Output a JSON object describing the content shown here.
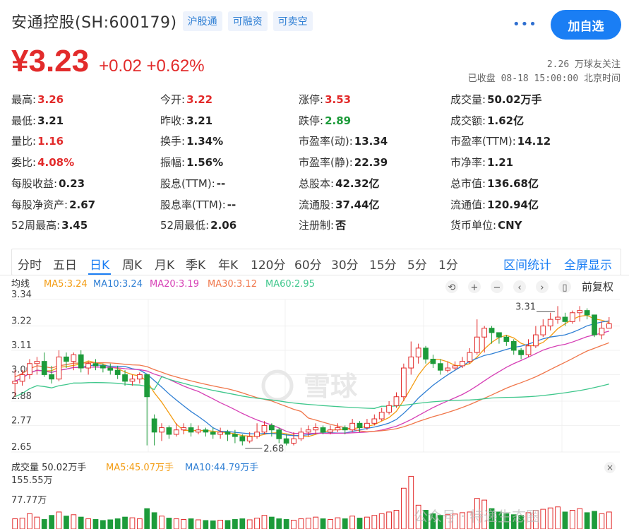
{
  "header": {
    "stock_name": "安通控股(SH:600179)",
    "tags": [
      "沪股通",
      "可融资",
      "可卖空"
    ],
    "add_button": "加自选",
    "more_icon": "more-dots-icon"
  },
  "price": {
    "current": "¥3.23",
    "change": "+0.02 +0.62%",
    "followers": "2.26 万球友关注",
    "status": "已收盘 08-18 15:00:00 北京时间"
  },
  "quote": {
    "rows": [
      [
        [
          "最高:",
          "3.26",
          "red"
        ],
        [
          "今开:",
          "3.22",
          "red"
        ],
        [
          "涨停:",
          "3.53",
          "red"
        ],
        [
          "成交量:",
          "50.02万手",
          ""
        ]
      ],
      [
        [
          "最低:",
          "3.21",
          ""
        ],
        [
          "昨收:",
          "3.21",
          ""
        ],
        [
          "跌停:",
          "2.89",
          "green"
        ],
        [
          "成交额:",
          "1.62亿",
          ""
        ]
      ],
      [
        [
          "量比:",
          "1.16",
          "red"
        ],
        [
          "换手:",
          "1.34%",
          ""
        ],
        [
          "市盈率(动):",
          "13.34",
          ""
        ],
        [
          "市盈率(TTM):",
          "14.12",
          ""
        ]
      ],
      [
        [
          "委比:",
          "4.08%",
          "red"
        ],
        [
          "振幅:",
          "1.56%",
          ""
        ],
        [
          "市盈率(静):",
          "22.39",
          ""
        ],
        [
          "市净率:",
          "1.21",
          ""
        ]
      ],
      [
        [
          "每股收益:",
          "0.23",
          ""
        ],
        [
          "股息(TTM):",
          "--",
          ""
        ],
        [
          "总股本:",
          "42.32亿",
          ""
        ],
        [
          "总市值:",
          "136.68亿",
          ""
        ]
      ],
      [
        [
          "每股净资产:",
          "2.67",
          ""
        ],
        [
          "股息率(TTM):",
          "--",
          ""
        ],
        [
          "流通股:",
          "37.44亿",
          ""
        ],
        [
          "流通值:",
          "120.94亿",
          ""
        ]
      ],
      [
        [
          "52周最高:",
          "3.45",
          ""
        ],
        [
          "52周最低:",
          "2.06",
          ""
        ],
        [
          "注册制:",
          "否",
          ""
        ],
        [
          "货币单位:",
          "CNY",
          ""
        ]
      ]
    ]
  },
  "tabs": {
    "items": [
      "分时",
      "五日",
      "日K",
      "周K",
      "月K",
      "季K",
      "年K",
      "120分",
      "60分",
      "30分",
      "15分",
      "5分",
      "1分"
    ],
    "active": "日K",
    "right": [
      "区间统计",
      "全屏显示"
    ]
  },
  "kline": {
    "ma_title": "均线",
    "ma_legend": [
      {
        "label": "MA5:3.24",
        "color": "#f39c12"
      },
      {
        "label": "MA10:3.24",
        "color": "#2f7fd4"
      },
      {
        "label": "MA20:3.19",
        "color": "#d63fb5"
      },
      {
        "label": "MA30:3.12",
        "color": "#f0764a"
      },
      {
        "label": "MA60:2.95",
        "color": "#3fc78c"
      }
    ],
    "toolbar_icons": [
      "undo-icon",
      "zoom-in-icon",
      "zoom-out-icon",
      "pan-left-icon",
      "pan-right-icon",
      "candle-type-icon"
    ],
    "adjust_label": "前复权",
    "y_ticks": [
      "3.34",
      "3.22",
      "3.11",
      "3.00",
      "2.88",
      "2.77",
      "2.65"
    ],
    "y_values": [
      3.34,
      3.22,
      3.11,
      3.0,
      2.88,
      2.77,
      2.65
    ],
    "max_label": "3.31",
    "min_label": "2.68",
    "watermark": "雪球",
    "vol_title": "成交量 50.02万手",
    "vol_legend": [
      {
        "label": "MA5:45.07万手",
        "color": "#f39c12"
      },
      {
        "label": "MA10:44.79万手",
        "color": "#2f7fd4"
      }
    ],
    "vol_ticks": [
      "155.55万",
      "77.77万"
    ],
    "vol_watermark": "公众号 · 特递生态圈",
    "colors": {
      "up": "#e22b2b",
      "down": "#1d9b3a"
    }
  },
  "chart_data": {
    "type": "candlestick",
    "ylim": [
      2.65,
      3.34
    ],
    "candles": [
      [
        2.96,
        2.97,
        2.9,
        3.02
      ],
      [
        2.97,
        3.0,
        2.95,
        3.02
      ],
      [
        3.0,
        3.05,
        2.98,
        3.07
      ],
      [
        3.05,
        3.06,
        3.0,
        3.08
      ],
      [
        3.06,
        3.0,
        2.99,
        3.1
      ],
      [
        3.0,
        2.98,
        2.96,
        3.04
      ],
      [
        2.98,
        3.08,
        2.97,
        3.11
      ],
      [
        3.08,
        3.06,
        3.03,
        3.1
      ],
      [
        3.06,
        3.09,
        3.02,
        3.1
      ],
      [
        3.09,
        3.03,
        3.01,
        3.11
      ],
      [
        3.03,
        3.05,
        3.0,
        3.06
      ],
      [
        3.05,
        3.04,
        3.02,
        3.07
      ],
      [
        3.04,
        3.03,
        3.01,
        3.05
      ],
      [
        3.03,
        3.02,
        3.0,
        3.05
      ],
      [
        3.02,
        3.0,
        2.98,
        3.04
      ],
      [
        3.0,
        2.97,
        2.95,
        3.02
      ],
      [
        2.97,
        2.98,
        2.95,
        3.0
      ],
      [
        2.98,
        3.0,
        2.96,
        3.01
      ],
      [
        3.0,
        2.9,
        2.68,
        3.0
      ],
      [
        2.8,
        2.74,
        2.68,
        2.82
      ],
      [
        2.74,
        2.76,
        2.7,
        2.78
      ],
      [
        2.76,
        2.73,
        2.71,
        2.77
      ],
      [
        2.73,
        2.75,
        2.72,
        2.78
      ],
      [
        2.75,
        2.76,
        2.73,
        2.78
      ],
      [
        2.76,
        2.74,
        2.72,
        2.78
      ],
      [
        2.74,
        2.75,
        2.73,
        2.77
      ],
      [
        2.75,
        2.74,
        2.72,
        2.76
      ],
      [
        2.74,
        2.73,
        2.71,
        2.76
      ],
      [
        2.73,
        2.74,
        2.71,
        2.76
      ],
      [
        2.74,
        2.73,
        2.7,
        2.75
      ],
      [
        2.73,
        2.72,
        2.69,
        2.75
      ],
      [
        2.72,
        2.7,
        2.68,
        2.73
      ],
      [
        2.7,
        2.72,
        2.69,
        2.74
      ],
      [
        2.72,
        2.74,
        2.71,
        2.78
      ],
      [
        2.74,
        2.77,
        2.73,
        2.79
      ],
      [
        2.77,
        2.75,
        2.72,
        2.78
      ],
      [
        2.75,
        2.71,
        2.69,
        2.76
      ],
      [
        2.71,
        2.69,
        2.68,
        2.73
      ],
      [
        2.69,
        2.71,
        2.68,
        2.74
      ],
      [
        2.71,
        2.74,
        2.7,
        2.76
      ],
      [
        2.74,
        2.75,
        2.72,
        2.77
      ],
      [
        2.75,
        2.76,
        2.73,
        2.78
      ],
      [
        2.76,
        2.74,
        2.73,
        2.77
      ],
      [
        2.74,
        2.75,
        2.73,
        2.77
      ],
      [
        2.75,
        2.76,
        2.74,
        2.78
      ],
      [
        2.76,
        2.75,
        2.73,
        2.77
      ],
      [
        2.75,
        2.78,
        2.74,
        2.8
      ],
      [
        2.78,
        2.76,
        2.74,
        2.79
      ],
      [
        2.76,
        2.78,
        2.75,
        2.8
      ],
      [
        2.78,
        2.8,
        2.77,
        2.82
      ],
      [
        2.8,
        2.83,
        2.79,
        2.85
      ],
      [
        2.83,
        2.86,
        2.82,
        2.88
      ],
      [
        2.86,
        2.9,
        2.85,
        2.92
      ],
      [
        2.9,
        3.03,
        2.88,
        3.05
      ],
      [
        3.03,
        3.08,
        3.0,
        3.15
      ],
      [
        3.08,
        3.12,
        3.05,
        3.14
      ],
      [
        3.12,
        3.07,
        3.05,
        3.13
      ],
      [
        3.07,
        3.05,
        3.03,
        3.09
      ],
      [
        3.05,
        3.02,
        3.0,
        3.07
      ],
      [
        3.02,
        3.03,
        3.01,
        3.06
      ],
      [
        3.03,
        3.04,
        3.02,
        3.06
      ],
      [
        3.04,
        3.06,
        3.03,
        3.08
      ],
      [
        3.06,
        3.1,
        3.05,
        3.12
      ],
      [
        3.1,
        3.17,
        3.09,
        3.25
      ],
      [
        3.17,
        3.21,
        3.1,
        3.22
      ],
      [
        3.21,
        3.19,
        3.14,
        3.22
      ],
      [
        3.19,
        3.17,
        3.14,
        3.19
      ],
      [
        3.17,
        3.15,
        3.13,
        3.18
      ],
      [
        3.15,
        3.11,
        3.09,
        3.16
      ],
      [
        3.11,
        3.09,
        3.07,
        3.12
      ],
      [
        3.09,
        3.13,
        3.08,
        3.16
      ],
      [
        3.13,
        3.18,
        3.12,
        3.22
      ],
      [
        3.18,
        3.22,
        3.17,
        3.25
      ],
      [
        3.22,
        3.25,
        3.2,
        3.28
      ],
      [
        3.25,
        3.26,
        3.23,
        3.31
      ],
      [
        3.26,
        3.24,
        3.22,
        3.28
      ],
      [
        3.24,
        3.28,
        3.23,
        3.29
      ],
      [
        3.28,
        3.29,
        3.24,
        3.31
      ],
      [
        3.29,
        3.27,
        3.25,
        3.3
      ],
      [
        3.27,
        3.18,
        3.17,
        3.27
      ],
      [
        3.18,
        3.21,
        3.16,
        3.24
      ],
      [
        3.21,
        3.23,
        3.21,
        3.26
      ]
    ],
    "volumes": [
      30,
      32,
      45,
      35,
      28,
      40,
      50,
      38,
      42,
      35,
      30,
      28,
      25,
      27,
      30,
      35,
      33,
      30,
      60,
      48,
      38,
      32,
      30,
      28,
      30,
      27,
      25,
      24,
      26,
      25,
      28,
      30,
      27,
      32,
      40,
      35,
      30,
      28,
      26,
      30,
      32,
      35,
      30,
      28,
      33,
      30,
      38,
      32,
      35,
      40,
      45,
      50,
      55,
      120,
      155,
      70,
      55,
      45,
      40,
      42,
      44,
      48,
      50,
      90,
      85,
      60,
      50,
      45,
      42,
      40,
      48,
      55,
      58,
      62,
      65,
      50,
      55,
      60,
      48,
      52,
      45,
      50
    ]
  }
}
